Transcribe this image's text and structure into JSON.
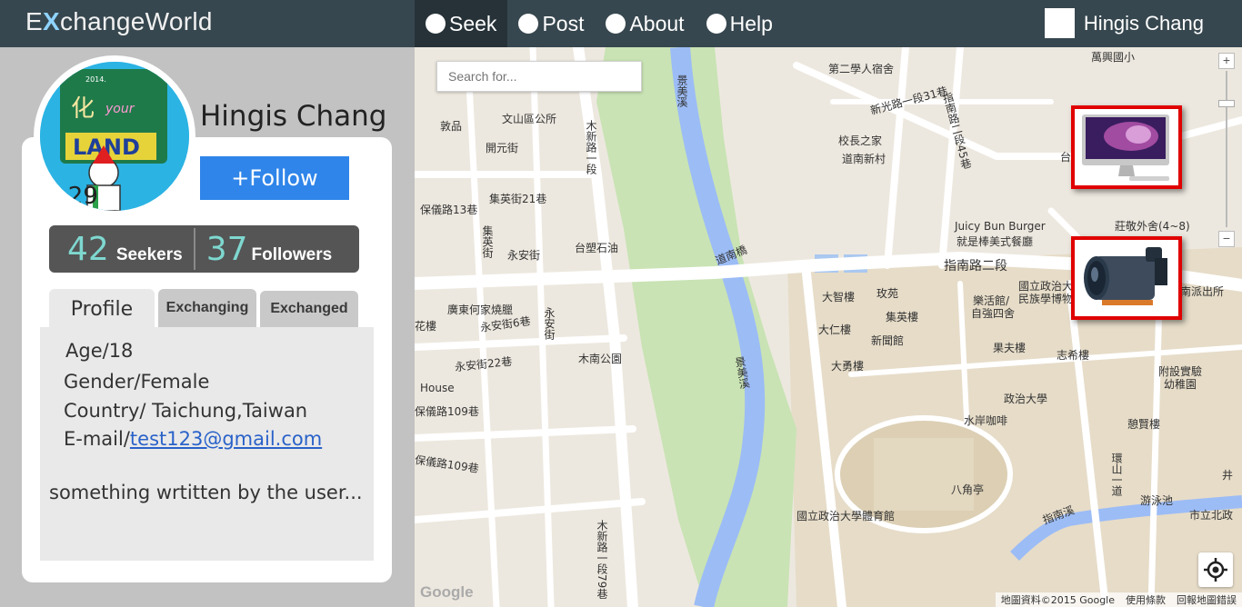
{
  "app": {
    "brand_pre": "E",
    "brand_x": "X",
    "brand_post": "changeWorld"
  },
  "nav": {
    "items": [
      {
        "label": "Seek",
        "active": true
      },
      {
        "label": "Post",
        "active": false
      },
      {
        "label": "About",
        "active": false
      },
      {
        "label": "Help",
        "active": false
      }
    ]
  },
  "user": {
    "name": "Hingis Chang"
  },
  "profile": {
    "name": "Hingis Chang",
    "follow_label": "+Follow",
    "seekers_count": "42",
    "seekers_label": "Seekers",
    "followers_count": "37",
    "followers_label": "Followers",
    "avatar_text_top": "2014.",
    "avatar_text_land": "LAND",
    "avatar_text_year": "2  29"
  },
  "tabs": [
    {
      "label": "Profile",
      "active": true
    },
    {
      "label": "Exchanging",
      "active": false
    },
    {
      "label": "Exchanged",
      "active": false
    }
  ],
  "info": {
    "age": "Age/18",
    "gender": "Gender/Female",
    "country": "Country/ Taichung,Taiwan",
    "email_prefix": "E-mail/",
    "email": "test123@gmail.com",
    "bio": "something wrtitten by the user..."
  },
  "map": {
    "search_placeholder": "Search for...",
    "zoom_in": "+",
    "zoom_out": "−",
    "google": "Google",
    "attribution": "地圖資料©2015 Google",
    "terms": "使用條款",
    "report": "回報地圖錯誤",
    "labels": {
      "l1": "萬興國小",
      "l2": "第二學人宿舍",
      "l3": "新光路一段31巷",
      "l4": "指南路二段45巷",
      "l5": "校長之家",
      "l6": "道南新村",
      "l7": "文山區公所",
      "l8": "開元街",
      "l9": "敦品",
      "l10": "集英街21巷",
      "l11": "保儀路13巷",
      "l12": "木新路一段",
      "l13": "景美溪",
      "l14": "台塑石油",
      "l15": "永安街",
      "l16": "集英街",
      "l17": "道南橋",
      "l18": "指南路二段",
      "l19": "Juicy Bun Burger",
      "l20": "就是棒美式餐廳",
      "l21": "莊敬外舍(4~8)",
      "l22": "國立政治大",
      "l23": "民族學博物",
      "l24": "大智樓",
      "l25": "玫苑",
      "l26": "樂活館/",
      "l27": "自強四舍",
      "l28": "集英樓",
      "l29": "大仁樓",
      "l30": "新聞館",
      "l31": "大勇樓",
      "l32": "果夫樓",
      "l33": "志希樓",
      "l34": "附設實驗",
      "l35": "幼稚園",
      "l36": "廣東何家燒臘",
      "l37": "永安街6巷",
      "l38": "木南公園",
      "l39": "永安街22巷",
      "l40": "保儀路109巷",
      "l41": "保儀路109巷",
      "l42": "政治大學",
      "l43": "水岸咖啡",
      "l44": "憩賢樓",
      "l45": "八角亭",
      "l46": "國立政治大學體育館",
      "l47": "游泳池",
      "l48": "指南溪",
      "l49": "市立北政",
      "l50": "井",
      "l51": "台北",
      "l52": "南派出所",
      "l53": "House",
      "l54": "永安街",
      "l55": "花樓",
      "l56": "景美溪",
      "l57": "木新路一段79巷",
      "l58": "環山一道"
    }
  }
}
